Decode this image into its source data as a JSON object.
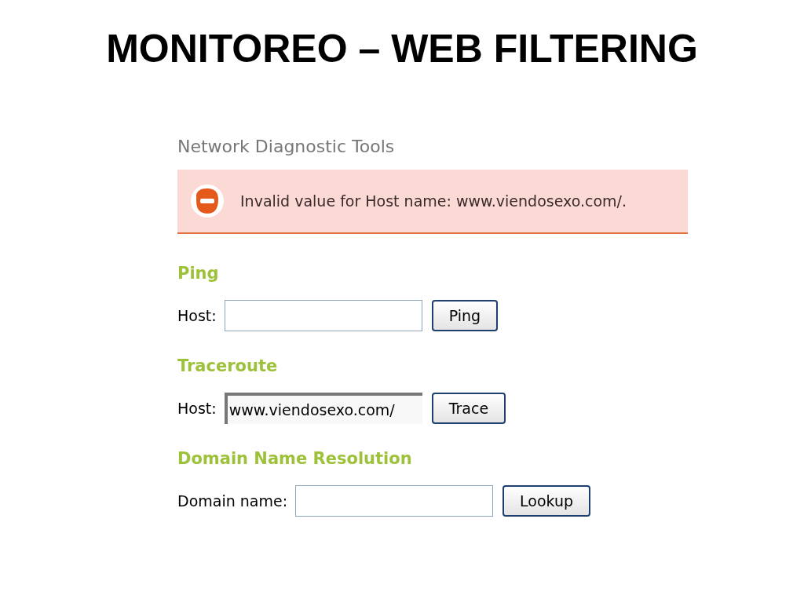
{
  "slide_title": "MONITOREO – WEB FILTERING",
  "page_title": "Network Diagnostic Tools",
  "error": {
    "message": "Invalid value for Host name: www.viendosexo.com/."
  },
  "sections": [
    {
      "heading": "Ping",
      "label": "Host:",
      "focused": false,
      "button": "Ping"
    },
    {
      "heading": "Traceroute",
      "label": "Host:",
      "value": "www.viendosexo.com/",
      "focused": true,
      "button": "Trace"
    },
    {
      "heading": "Domain Name Resolution",
      "label": "Domain name:",
      "focused": false,
      "button": "Lookup"
    }
  ]
}
